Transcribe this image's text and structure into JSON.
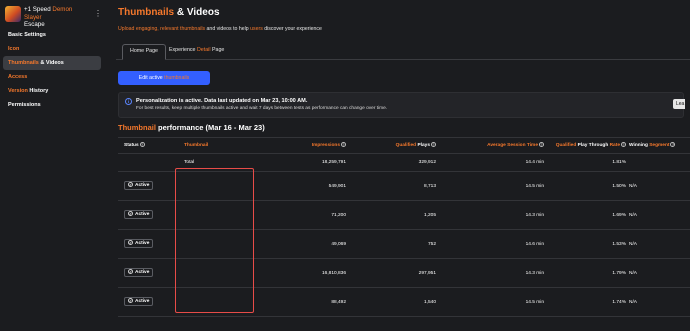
{
  "sidebar": {
    "game_title_prefix": "+1 Speed ",
    "game_title_accent": "Demon Slayer",
    "game_title_suffix": "Escape",
    "items": [
      {
        "label": "Basic Settings",
        "accent": ""
      },
      {
        "label": "Icon",
        "accent": "Icon"
      },
      {
        "label": " & Videos",
        "accent": "Thumbnails"
      },
      {
        "label": "",
        "accent": "Access"
      },
      {
        "label": " History",
        "accent": "Version"
      },
      {
        "label": "Permissions",
        "accent": ""
      }
    ]
  },
  "header": {
    "title_accent": "Thumbnails",
    "title_rest": " & Videos",
    "subtitle_a": "Upload engaging, relevant",
    "subtitle_b": " thumbnails",
    "subtitle_c": " and videos to help ",
    "subtitle_d": "users",
    "subtitle_e": " discover your experience"
  },
  "tabs": [
    {
      "label": "Home Page",
      "accent": ""
    },
    {
      "label": "Experience ",
      "accent": "Detail",
      "suffix": " Page"
    }
  ],
  "edit_button": {
    "prefix": "Edit active ",
    "accent": "thumbnails"
  },
  "notice": {
    "title": "Personalization is active. Data last updated on Mar 23, 10:00 AM.",
    "body": "For best results, keep multiple thumbnails active and wait 7 days between tests as performance can change over time.",
    "learn_label": "Lea"
  },
  "section": {
    "accent": "Thumbnail",
    "rest": " performance (Mar 16 - Mar 23)"
  },
  "table": {
    "headers": {
      "status": "Status",
      "thumbnail": "Thumbnail",
      "impressions": "Impressions",
      "qualified_plays_a": "Qualified",
      "qualified_plays_b": " Plays",
      "ast": "Average Session Time",
      "qptr_a": "Qualified",
      "qptr_b": " Play Through ",
      "qptr_c": "Rate",
      "winning_a": "Winning ",
      "winning_b": "Segment"
    },
    "total": {
      "label": "Total",
      "impressions": "18,259,791",
      "qualified_plays": "329,912",
      "ast": "14.4 min",
      "qptr": "1.81%"
    },
    "rows": [
      {
        "status": "Active",
        "impressions": "549,901",
        "qualified_plays": "8,713",
        "ast": "14.5 min",
        "qptr": "1.50%",
        "winning": "N/A"
      },
      {
        "status": "Active",
        "impressions": "71,200",
        "qualified_plays": "1,205",
        "ast": "14.3 min",
        "qptr": "1.69%",
        "winning": "N/A"
      },
      {
        "status": "Active",
        "impressions": "49,069",
        "qualified_plays": "752",
        "ast": "14.6 min",
        "qptr": "1.53%",
        "winning": "N/A"
      },
      {
        "status": "Active",
        "impressions": "16,810,836",
        "qualified_plays": "297,951",
        "ast": "14.3 min",
        "qptr": "1.79%",
        "winning": "N/A"
      },
      {
        "status": "Active",
        "impressions": "88,492",
        "qualified_plays": "1,540",
        "ast": "14.5 min",
        "qptr": "1.74%",
        "winning": "N/A"
      }
    ]
  },
  "colors": {
    "accent": "#f5782c",
    "primary_button": "#335fff",
    "redaction_box": "#e74c48",
    "background": "#1b1c1f"
  }
}
